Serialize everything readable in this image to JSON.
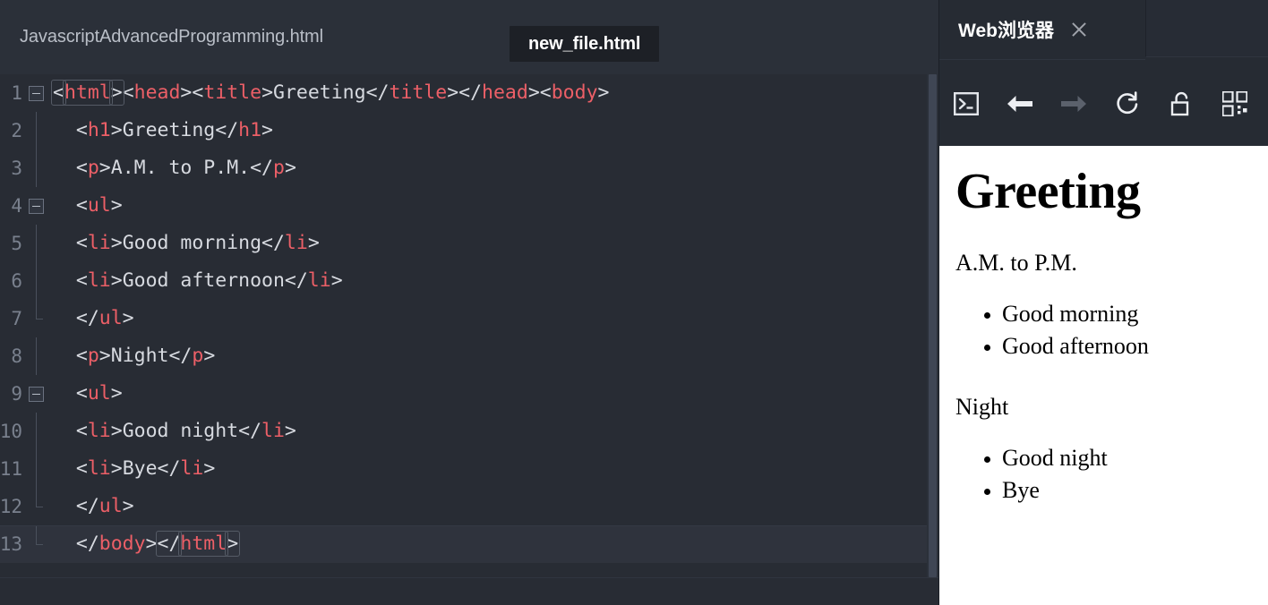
{
  "editor": {
    "tabs": [
      {
        "label": "JavascriptAdvancedProgramming.html",
        "active": false
      },
      {
        "label": "new_file.html",
        "active": true
      }
    ],
    "syntax_colors": {
      "tag": "#ec5f67",
      "punctuation": "#d7dae0",
      "text": "#d7dae0",
      "background": "#282c34",
      "gutter_text": "#79808d",
      "current_line": "#2f333d"
    },
    "lines": [
      {
        "no": "1",
        "fold": true,
        "guide": "none",
        "current": false,
        "tokens": [
          {
            "t": "pnc",
            "v": "<"
          },
          {
            "t": "tag",
            "v": "html"
          },
          {
            "t": "pnc",
            "v": ">"
          },
          {
            "t": "pnc",
            "v": "<"
          },
          {
            "t": "tag",
            "v": "head"
          },
          {
            "t": "pnc",
            "v": ">"
          },
          {
            "t": "pnc",
            "v": "<"
          },
          {
            "t": "tag",
            "v": "title"
          },
          {
            "t": "pnc",
            "v": ">"
          },
          {
            "t": "txt",
            "v": "Greeting"
          },
          {
            "t": "pnc",
            "v": "</"
          },
          {
            "t": "tag",
            "v": "title"
          },
          {
            "t": "pnc",
            "v": ">"
          },
          {
            "t": "pnc",
            "v": "</"
          },
          {
            "t": "tag",
            "v": "head"
          },
          {
            "t": "pnc",
            "v": ">"
          },
          {
            "t": "pnc",
            "v": "<"
          },
          {
            "t": "tag",
            "v": "body"
          },
          {
            "t": "pnc",
            "v": ">"
          }
        ],
        "plain": "<html><head><title>Greeting</title></head><body>"
      },
      {
        "no": "2",
        "fold": false,
        "guide": "line",
        "current": false,
        "plain": "  <h1>Greeting</h1>"
      },
      {
        "no": "3",
        "fold": false,
        "guide": "line",
        "current": false,
        "plain": "  <p>A.M. to P.M.</p>"
      },
      {
        "no": "4",
        "fold": true,
        "guide": "none",
        "current": false,
        "plain": "  <ul>"
      },
      {
        "no": "5",
        "fold": false,
        "guide": "line",
        "current": false,
        "plain": "  <li>Good morning</li>"
      },
      {
        "no": "6",
        "fold": false,
        "guide": "line",
        "current": false,
        "plain": "  <li>Good afternoon</li>"
      },
      {
        "no": "7",
        "fold": false,
        "guide": "end",
        "current": false,
        "plain": "  </ul>"
      },
      {
        "no": "8",
        "fold": false,
        "guide": "line",
        "current": false,
        "plain": "  <p>Night</p>"
      },
      {
        "no": "9",
        "fold": true,
        "guide": "none",
        "current": false,
        "plain": "  <ul>"
      },
      {
        "no": "10",
        "fold": false,
        "guide": "line",
        "current": false,
        "plain": "  <li>Good night</li>"
      },
      {
        "no": "11",
        "fold": false,
        "guide": "line",
        "current": false,
        "plain": "  <li>Bye</li>"
      },
      {
        "no": "12",
        "fold": false,
        "guide": "end",
        "current": false,
        "plain": "  </ul>"
      },
      {
        "no": "13",
        "fold": false,
        "guide": "end",
        "current": true,
        "plain": "  </body></html>"
      }
    ]
  },
  "browser": {
    "tab_title": "Web浏览器",
    "close_icon": "close-icon",
    "toolbar": [
      {
        "name": "console-icon",
        "label": "Console",
        "enabled": true
      },
      {
        "name": "back-arrow-icon",
        "label": "Back",
        "enabled": true
      },
      {
        "name": "forward-arrow-icon",
        "label": "Forward",
        "enabled": false
      },
      {
        "name": "reload-icon",
        "label": "Reload",
        "enabled": true
      },
      {
        "name": "unlock-icon",
        "label": "Unlocked",
        "enabled": true
      },
      {
        "name": "qr-code-icon",
        "label": "QR Code",
        "enabled": true
      }
    ],
    "page": {
      "heading": "Greeting",
      "paragraph1": "A.M. to P.M.",
      "list1": [
        "Good morning",
        "Good afternoon"
      ],
      "paragraph2": "Night",
      "list2": [
        "Good night",
        "Bye"
      ]
    }
  }
}
